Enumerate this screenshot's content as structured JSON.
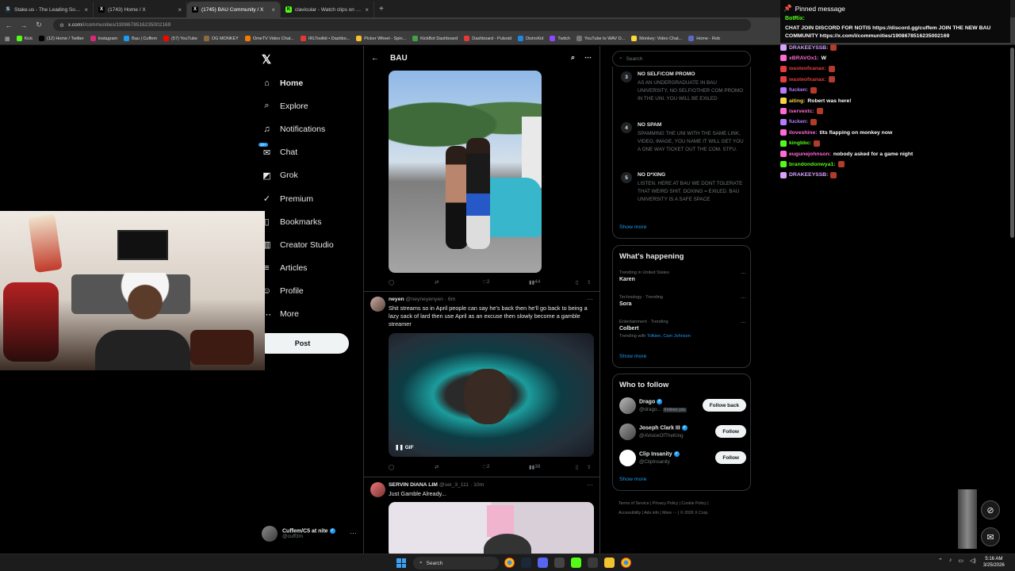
{
  "browser": {
    "tabs": [
      {
        "title": "Stake.us - The Leading Social C",
        "icon": "stake-icon",
        "color": "#1a2c38",
        "active": false
      },
      {
        "title": "(1743) Home / X",
        "icon": "x-icon",
        "color": "#000000",
        "active": false
      },
      {
        "title": "(1745) BAU Community / X",
        "icon": "x-icon",
        "color": "#000000",
        "active": true
      },
      {
        "title": "clavicular - Watch clips on Kick",
        "icon": "kick-icon",
        "color": "#53fc18",
        "active": false
      }
    ],
    "url_host": "x.com",
    "url_path": "/i/communities/1908678516235002169",
    "bookmarks": [
      {
        "label": "Kick",
        "color": "#53fc18"
      },
      {
        "label": "(12) Home / Twitter",
        "color": "#000000"
      },
      {
        "label": "Instagram",
        "color": "#d62976"
      },
      {
        "label": "Bau | Cuffem",
        "color": "#1d9bf0"
      },
      {
        "label": "(57) YouTube",
        "color": "#ff0000"
      },
      {
        "label": "OG MONKEY",
        "color": "#8a6d3b"
      },
      {
        "label": "OmeTV Video Chat...",
        "color": "#f57c00"
      },
      {
        "label": "IRLToolkit • Dashbo...",
        "color": "#e53935"
      },
      {
        "label": "Picker Wheel - Spin...",
        "color": "#fbc02d"
      },
      {
        "label": "KickBot Dashboard",
        "color": "#43a047"
      },
      {
        "label": "Dashboard - Pulsoid",
        "color": "#e53935"
      },
      {
        "label": "DistroKid",
        "color": "#1e88e5"
      },
      {
        "label": "Twitch",
        "color": "#9146ff"
      },
      {
        "label": "YouTube to WAV D...",
        "color": "#757575"
      },
      {
        "label": "Monkey: Video Chat...",
        "color": "#fdd835"
      },
      {
        "label": "Home - Rob",
        "color": "#5c6bc0"
      }
    ]
  },
  "sidebar": {
    "items": [
      {
        "label": "Home",
        "icon": "home-icon",
        "glyph": "⌂"
      },
      {
        "label": "Explore",
        "icon": "search-icon",
        "glyph": "⌕"
      },
      {
        "label": "Notifications",
        "icon": "bell-icon",
        "glyph": "♫"
      },
      {
        "label": "Chat",
        "icon": "chat-icon",
        "glyph": "✉",
        "badge": "20+"
      },
      {
        "label": "Grok",
        "icon": "grok-icon",
        "glyph": "◩"
      },
      {
        "label": "Premium",
        "icon": "premium-icon",
        "glyph": "✓"
      },
      {
        "label": "Bookmarks",
        "icon": "bookmark-icon",
        "glyph": "▯"
      },
      {
        "label": "Creator Studio",
        "icon": "creator-studio-icon",
        "glyph": "▥"
      },
      {
        "label": "Articles",
        "icon": "articles-icon",
        "glyph": "≡"
      },
      {
        "label": "Profile",
        "icon": "profile-icon",
        "glyph": "☺"
      },
      {
        "label": "More",
        "icon": "more-icon",
        "glyph": "⋯"
      }
    ],
    "post_label": "Post",
    "account": {
      "name": "Cuffem/C5 at nite",
      "handle": "@cuff3m"
    }
  },
  "main": {
    "title": "BAU",
    "post1": {
      "likes": "2",
      "views": "44"
    },
    "post2": {
      "name": "neyen",
      "handle": "@neyneyenyen",
      "time": "· 6m",
      "text": "Shit streams so in April people can say he's back then he'll go back to being a lazy sack of lard then use April as an excuse then slowly become a gamble streamer",
      "gif_label": "GIF",
      "likes": "2",
      "views": "38"
    },
    "post3": {
      "name": "SERVIN DIANA LIM",
      "handle": "@sei_3_111",
      "time": "· 10m",
      "text": "Just Gamble Already..."
    }
  },
  "right": {
    "search_placeholder": "Search",
    "rules": [
      {
        "num": "3",
        "title": "NO SELF/COM PROMO",
        "desc": "AS AN UNDERGRADUATE IN BAU UNIVERSITY, NO SELF/OTHER COM PROMO IN THE UNI. YOU WILL BE EXILED"
      },
      {
        "num": "4",
        "title": "NO SPAM",
        "desc": "SPAMMING THE UNI WITH THE SAME LINK, VIDEO, IMAGE, YOU NAME IT WILL GET YOU A ONE WAY TICKET OUT THE COM. STFU."
      },
      {
        "num": "5",
        "title": "NO D*XING",
        "desc": "LISTEN. HERE AT BAU WE DONT TOLERATE THAT WEIRD SHIT. DOXING = EXILED. BAU UNIVERSITY IS A SAFE SPACE"
      }
    ],
    "show_more": "Show more",
    "happening": {
      "title": "What's happening",
      "trends": [
        {
          "context": "Trending in United States",
          "topic": "Karen"
        },
        {
          "context": "Technology · Trending",
          "topic": "Sora"
        },
        {
          "context": "Entertainment · Trending",
          "topic": "Colbert",
          "with_label": "Trending with",
          "with": "Tolkien, Cam Johnson"
        }
      ]
    },
    "who_to_follow": {
      "title": "Who to follow",
      "accounts": [
        {
          "name": "Drago",
          "handle": "@drago...",
          "follows_you": "Follows you",
          "button": "Follow back"
        },
        {
          "name": "Joseph Clark III",
          "handle": "@AVoiceOfTheKing",
          "button": "Follow"
        },
        {
          "name": "Clip Insanity",
          "handle": "@ClipInsanity",
          "button": "Follow"
        }
      ]
    },
    "footer": [
      "Terms of Service",
      "Privacy Policy",
      "Cookie Policy",
      "Accessibility",
      "Ads info",
      "More ···",
      "© 2026 X Corp."
    ]
  },
  "chat": {
    "pinned_header": "Pinned message",
    "pinned_user": "BotRix:",
    "pinned_text": "CHAT JOIN DISCORD FOR NOTIS https://discord.gg/cuffem JOIN THE NEW BAU COMMUNITY https://x.com/i/communities/1908678516235002169",
    "messages": [
      {
        "user": "DRAKEEYSSB:",
        "color": "#d8a2ff",
        "text": ""
      },
      {
        "user": "xBRAVOx1:",
        "color": "#ff6bd6",
        "text": "W"
      },
      {
        "user": "wasteofxanax:",
        "color": "#e23c3c",
        "text": ""
      },
      {
        "user": "wasteofxanax:",
        "color": "#e23c3c",
        "text": ""
      },
      {
        "user": "fucken:",
        "color": "#b57bff",
        "text": ""
      },
      {
        "user": "aiting:",
        "color": "#f5d442",
        "text": "Robert was here!"
      },
      {
        "user": "iservextc:",
        "color": "#ff6bd6",
        "text": ""
      },
      {
        "user": "fucken:",
        "color": "#b57bff",
        "text": ""
      },
      {
        "user": "iloveshine:",
        "color": "#ff6bd6",
        "text": "tits flapping on monkey now"
      },
      {
        "user": "kingbbc:",
        "color": "#53fc18",
        "text": ""
      },
      {
        "user": "eugunejohnson:",
        "color": "#ff6bd6",
        "text": "nobody asked for a game night"
      },
      {
        "user": "brandondonwya1:",
        "color": "#53fc18",
        "text": ""
      },
      {
        "user": "DRAKEEYSSB:",
        "color": "#d8a2ff",
        "text": ""
      }
    ]
  },
  "taskbar": {
    "search_label": "Search",
    "time": "5:16 AM",
    "date": "3/25/2026"
  }
}
